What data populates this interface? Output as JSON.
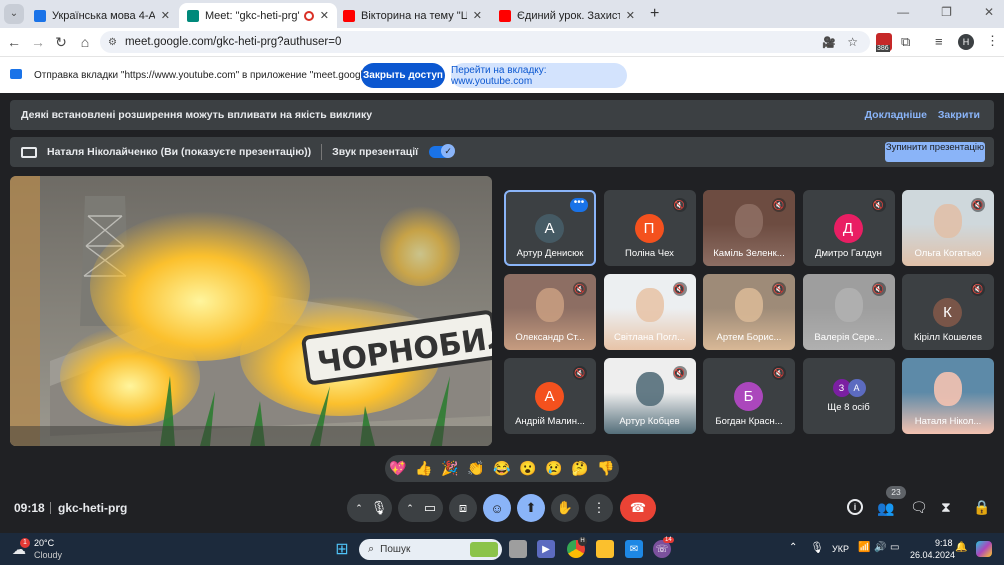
{
  "tabs": [
    {
      "title": "Українська мова 4-А",
      "icon": "classroom-icon",
      "color": "#1a73e8"
    },
    {
      "title": "Meet: \"gkc-heti-prg\"",
      "icon": "meet-icon",
      "color": "#00897b"
    },
    {
      "title": "Вікторина на тему \"Цивільний",
      "icon": "youtube-icon",
      "color": "#ff0000"
    },
    {
      "title": "Єдиний урок. Захисти сво",
      "icon": "youtube-icon",
      "color": "#ff0000"
    }
  ],
  "tab_close": "✕",
  "new_tab": "+",
  "url": "meet.google.com/gkc-heti-prg?authuser=0",
  "profile_initial": "Н",
  "ext_badge": "386",
  "infobar": {
    "text": "Отправка вкладки \"https://www.youtube.com\" в приложение \"meet.google.com\"...",
    "close": "Закрыть доступ",
    "switch": "Перейти на вкладку: www.youtube.com"
  },
  "ext_banner": {
    "text": "Деякі встановлені розширення можуть впливати на якість виклику",
    "more": "Докладніше",
    "close": "Закрити"
  },
  "present_banner": {
    "text": "Наталя Ніколайченко (Ви (показуєте презентацію))",
    "sound": "Звук презентації",
    "stop": "Зупинити презентацію"
  },
  "presentation": {
    "sign": "ЧОРНОБИЛ"
  },
  "participants": [
    {
      "name": "Артур Денисюк",
      "initial": "А",
      "color": "#455a64",
      "muted": false,
      "highlight": true
    },
    {
      "name": "Поліна Чех",
      "initial": "П",
      "color": "#f4511e",
      "muted": true
    },
    {
      "name": "Каміль Зеленк...",
      "photo": "room",
      "muted": true
    },
    {
      "name": "Дмитро Галдун",
      "initial": "Д",
      "color": "#e91e63",
      "muted": true
    },
    {
      "name": "Ольга Когатько",
      "photo": "woman",
      "muted": true
    },
    {
      "name": "Олександр Ст...",
      "photo": "boy",
      "muted": true
    },
    {
      "name": "Світлана Погл...",
      "photo": "girl",
      "muted": true
    },
    {
      "name": "Артем Борис...",
      "photo": "boy2",
      "muted": true
    },
    {
      "name": "Валерія Сере...",
      "photo": "wall",
      "muted": true
    },
    {
      "name": "Кірілл Кошелев",
      "initial": "К",
      "color": "#795548",
      "muted": true
    },
    {
      "name": "Андрій Малин...",
      "initial": "А",
      "color": "#f4511e",
      "muted": true
    },
    {
      "name": "Артур Кобцев",
      "photo": "kid",
      "muted": true
    },
    {
      "name": "Богдан Красн...",
      "initial": "Б",
      "color": "#ab47bc",
      "muted": true
    },
    {
      "name": "Ще 8 осіб",
      "others": [
        "З",
        "А"
      ]
    },
    {
      "name": "Наталя Нікол...",
      "photo": "self"
    }
  ],
  "reactions": [
    "💖",
    "👍",
    "🎉",
    "👏",
    "😂",
    "😮",
    "😢",
    "🤔",
    "👎"
  ],
  "meeting": {
    "time": "09:18",
    "code": "gkc-heti-prg",
    "people_count": "23"
  },
  "taskbar": {
    "temp": "20°C",
    "weather": "Cloudy",
    "weather_badge": "1",
    "search": "Пошук",
    "lang": "УКР",
    "time": "9:18",
    "date": "26.04.2024",
    "chrome_badge": "Н",
    "viber_badge": "14"
  }
}
